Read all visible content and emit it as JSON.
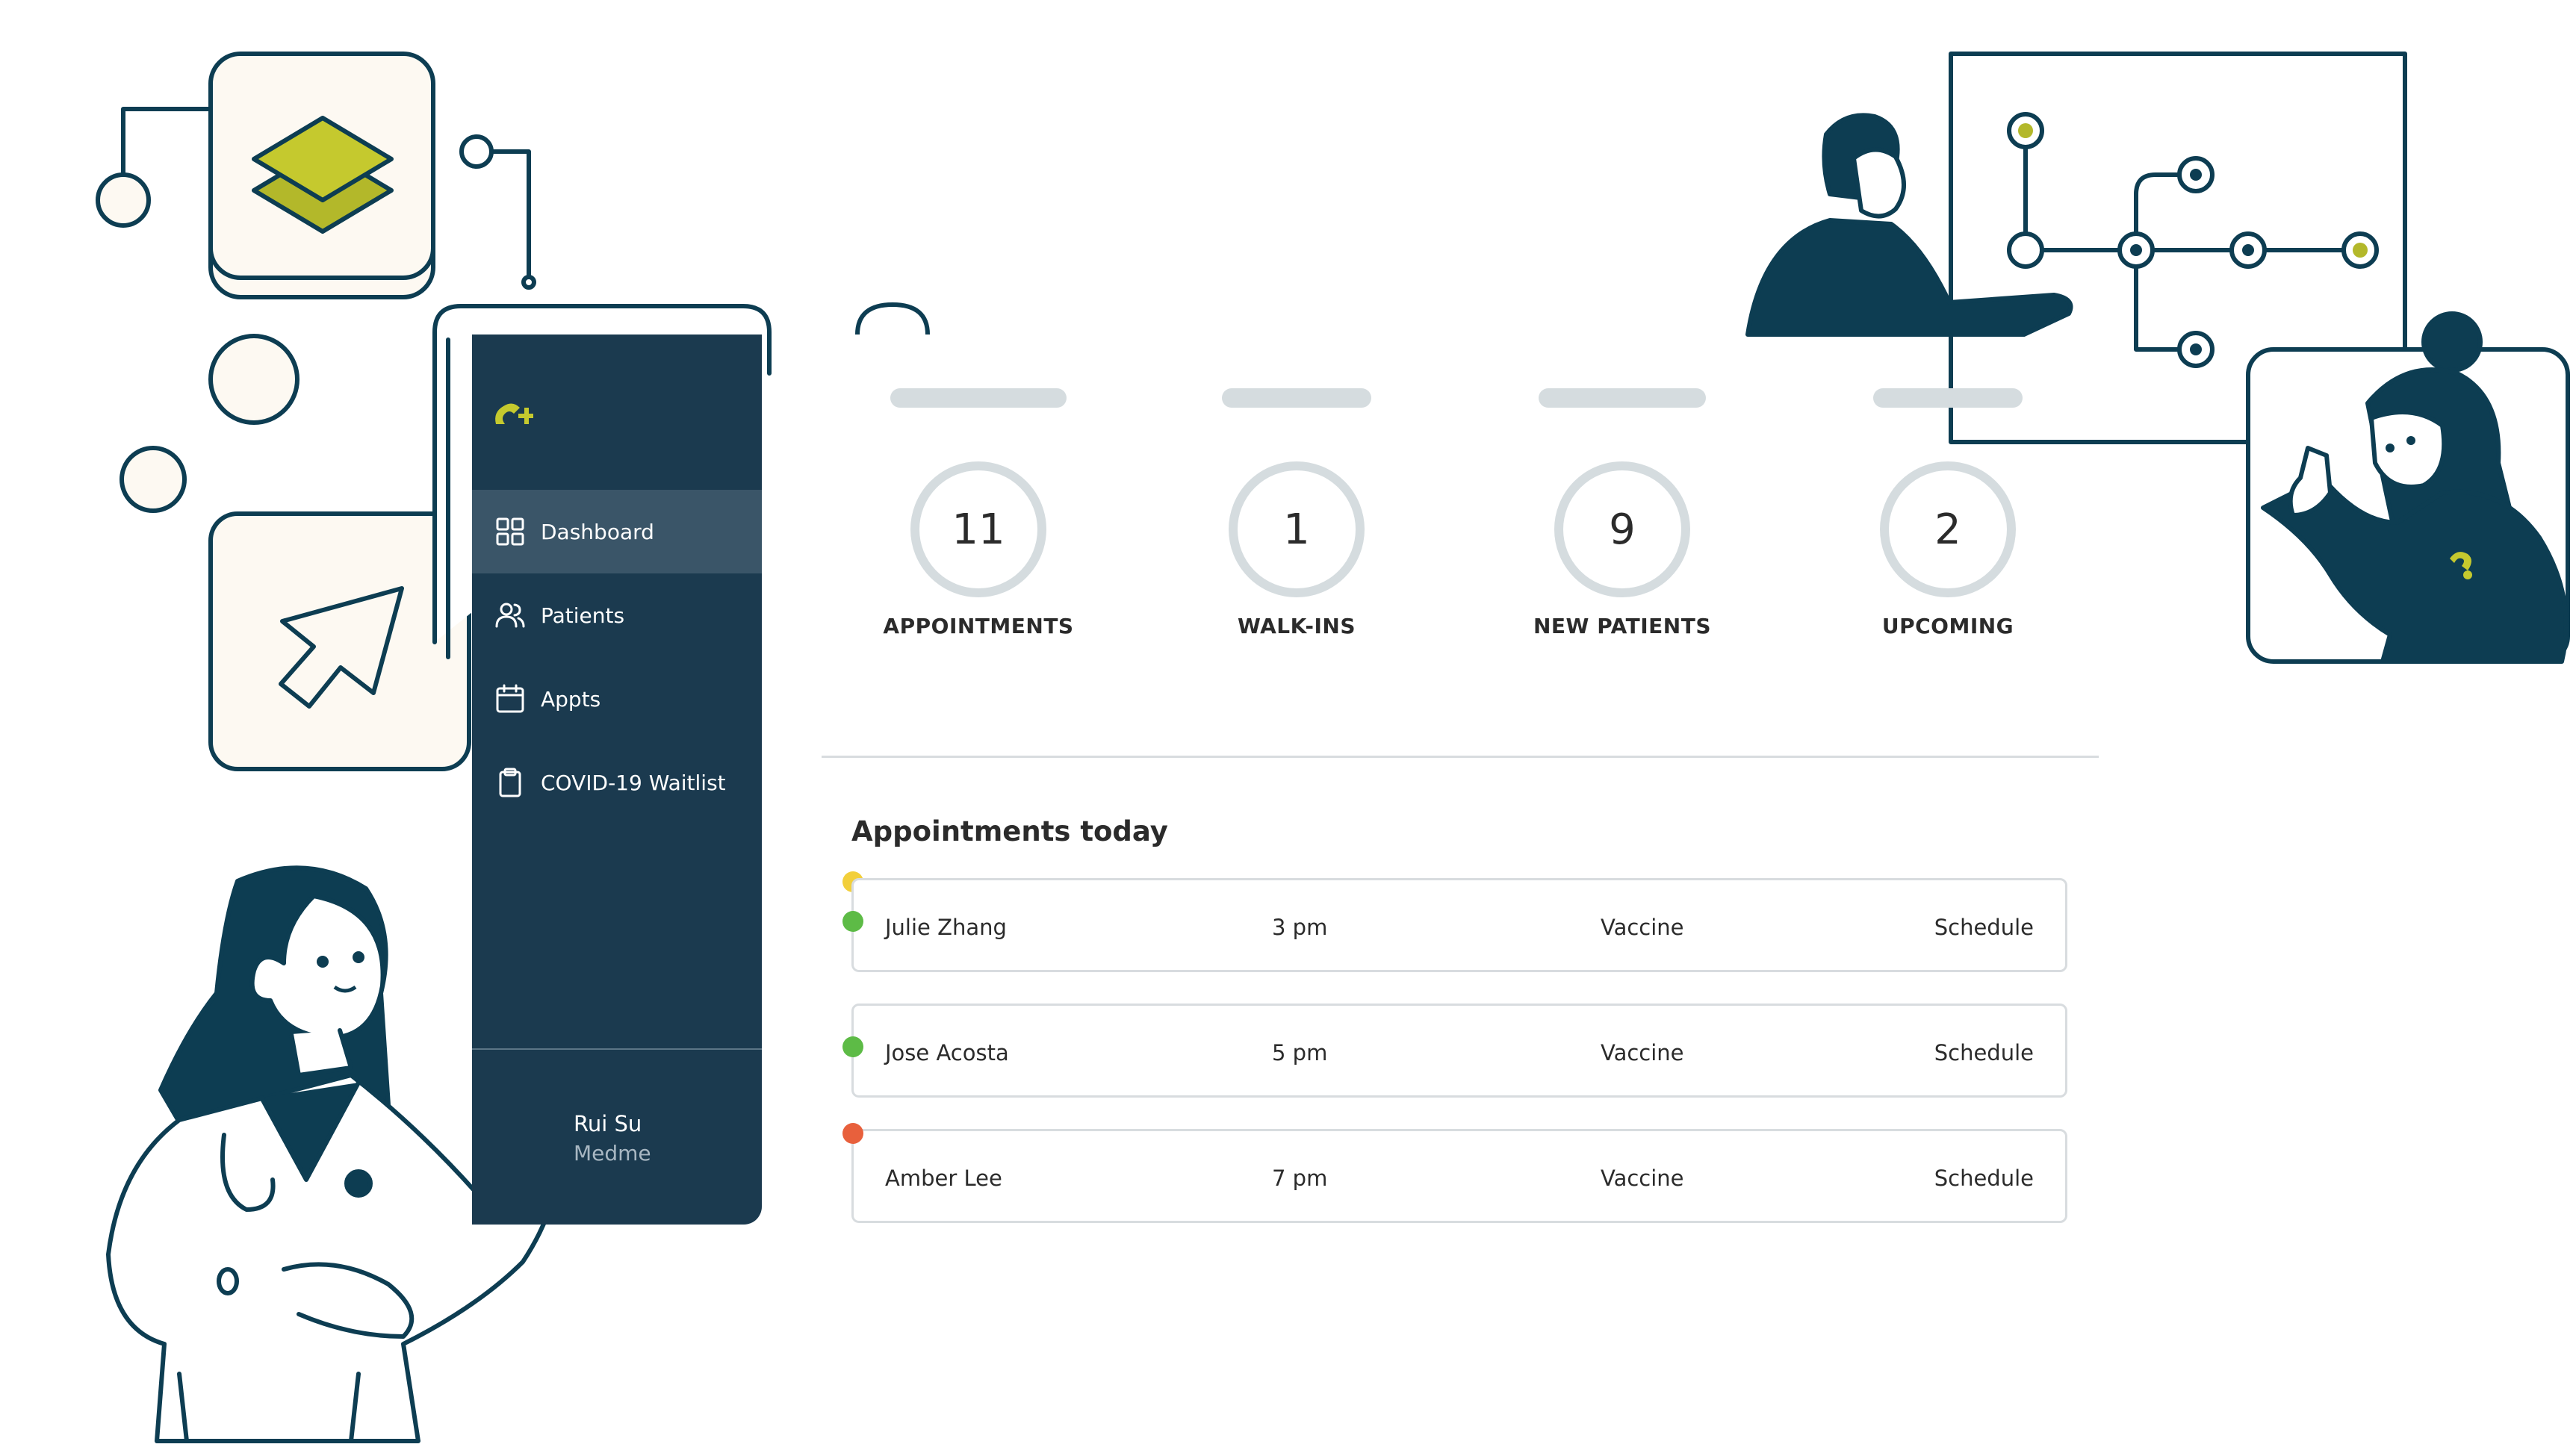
{
  "sidebar": {
    "items": [
      {
        "label": "Dashboard",
        "icon": "grid-icon",
        "active": true
      },
      {
        "label": "Patients",
        "icon": "users-icon",
        "active": false
      },
      {
        "label": "Appts",
        "icon": "calendar-icon",
        "active": false
      },
      {
        "label": "COVID-19 Waitlist",
        "icon": "clipboard-icon",
        "active": false
      }
    ],
    "user": {
      "name": "Rui Su",
      "org": "Medme"
    }
  },
  "stats": [
    {
      "value": "11",
      "label": "APPOINTMENTS"
    },
    {
      "value": "1",
      "label": "WALK-INS"
    },
    {
      "value": "9",
      "label": "NEW PATIENTS"
    },
    {
      "value": "2",
      "label": "UPCOMING"
    }
  ],
  "appointments": {
    "title": "Appointments today",
    "rows": [
      {
        "name": "Julie Zhang",
        "time": "3 pm",
        "type": "Vaccine",
        "action": "Schedule",
        "status_color": "#5dbb46"
      },
      {
        "name": "Jose Acosta",
        "time": "5 pm",
        "type": "Vaccine",
        "action": "Schedule",
        "status_color": "#5dbb46"
      },
      {
        "name": "Amber Lee",
        "time": "7 pm",
        "type": "Vaccine",
        "action": "Schedule",
        "status_color": "#e8603c"
      }
    ],
    "extra_indicator_color": "#f2cf3b"
  },
  "colors": {
    "sidebar_bg": "#1b3a4f",
    "sidebar_active": "#3a5568",
    "brand_accent": "#c5c92e",
    "illustration_navy": "#0d3d52",
    "card_cream": "#fdf9f2",
    "ring_gray": "#d5dcdf"
  }
}
